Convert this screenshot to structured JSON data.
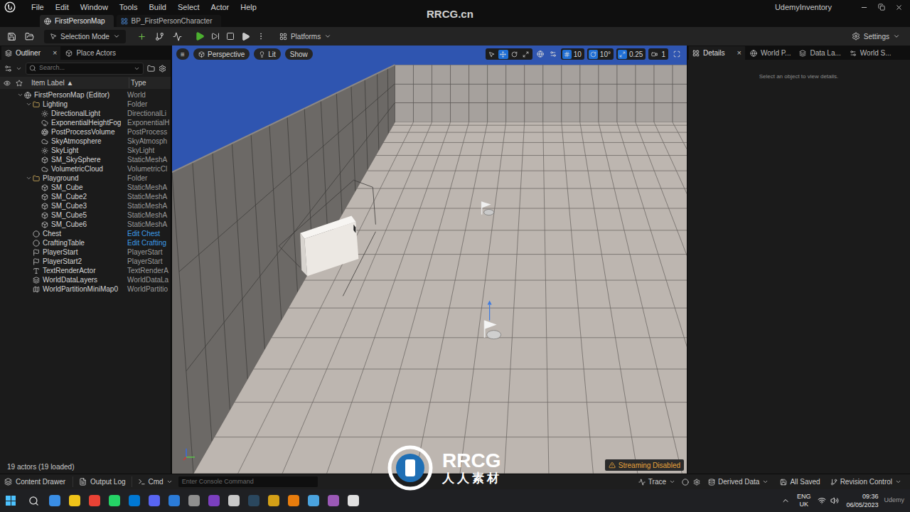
{
  "menu": [
    "File",
    "Edit",
    "Window",
    "Tools",
    "Build",
    "Select",
    "Actor",
    "Help"
  ],
  "project": "UdemyInventory",
  "document_tabs": [
    {
      "label": "FirstPersonMap",
      "selected": true
    },
    {
      "label": "BP_FirstPersonCharacter",
      "selected": false
    }
  ],
  "toolbar": {
    "mode": "Selection Mode",
    "platforms": "Platforms",
    "settings": "Settings"
  },
  "outliner": {
    "tabs": [
      {
        "label": "Outliner",
        "selected": true,
        "close": "×"
      },
      {
        "label": "Place Actors",
        "selected": false,
        "close": ""
      }
    ],
    "search": {
      "placeholder": "Search..."
    },
    "columns": [
      "Item Label ▲",
      "Type"
    ],
    "rows": [
      {
        "label": "FirstPersonMap (Editor)",
        "type": "World",
        "depth": 0,
        "kind": "world",
        "expanded": true,
        "selected": false
      },
      {
        "label": "Lighting",
        "type": "Folder",
        "depth": 1,
        "kind": "folder",
        "expanded": true,
        "selected": false
      },
      {
        "label": "DirectionalLight",
        "type": "DirectionalLi",
        "depth": 2,
        "kind": "light",
        "expanded": false,
        "selected": false
      },
      {
        "label": "ExponentialHeightFog",
        "type": "ExponentialH",
        "depth": 2,
        "kind": "fog",
        "expanded": false,
        "selected": false
      },
      {
        "label": "PostProcessVolume",
        "type": "PostProcess",
        "depth": 2,
        "kind": "volume",
        "expanded": false,
        "selected": false
      },
      {
        "label": "SkyAtmosphere",
        "type": "SkyAtmosph",
        "depth": 2,
        "kind": "sky",
        "expanded": false,
        "selected": false
      },
      {
        "label": "SkyLight",
        "type": "SkyLight",
        "depth": 2,
        "kind": "light",
        "expanded": false,
        "selected": false
      },
      {
        "label": "SM_SkySphere",
        "type": "StaticMeshA",
        "depth": 2,
        "kind": "mesh",
        "expanded": false,
        "selected": false
      },
      {
        "label": "VolumetricCloud",
        "type": "VolumetricCl",
        "depth": 2,
        "kind": "cloud",
        "expanded": false,
        "selected": false
      },
      {
        "label": "Playground",
        "type": "Folder",
        "depth": 1,
        "kind": "folder",
        "expanded": true,
        "selected": false
      },
      {
        "label": "SM_Cube",
        "type": "StaticMeshA",
        "depth": 2,
        "kind": "mesh",
        "expanded": false,
        "selected": false
      },
      {
        "label": "SM_Cube2",
        "type": "StaticMeshA",
        "depth": 2,
        "kind": "mesh",
        "expanded": false,
        "selected": false
      },
      {
        "label": "SM_Cube3",
        "type": "StaticMeshA",
        "depth": 2,
        "kind": "mesh",
        "expanded": false,
        "selected": false
      },
      {
        "label": "SM_Cube5",
        "type": "StaticMeshA",
        "depth": 2,
        "kind": "mesh",
        "expanded": false,
        "selected": false
      },
      {
        "label": "SM_Cube6",
        "type": "StaticMeshA",
        "depth": 2,
        "kind": "mesh",
        "expanded": false,
        "selected": false
      },
      {
        "label": "Chest",
        "type": "Edit Chest",
        "depth": 1,
        "kind": "blueprint",
        "expanded": false,
        "selected": false
      },
      {
        "label": "CraftingTable",
        "type": "Edit Crafting",
        "depth": 1,
        "kind": "blueprint",
        "expanded": false,
        "selected": false
      },
      {
        "label": "PlayerStart",
        "type": "PlayerStart",
        "depth": 1,
        "kind": "start",
        "expanded": false,
        "selected": false
      },
      {
        "label": "PlayerStart2",
        "type": "PlayerStart",
        "depth": 1,
        "kind": "start",
        "expanded": false,
        "selected": false
      },
      {
        "label": "TextRenderActor",
        "type": "TextRenderA",
        "depth": 1,
        "kind": "text",
        "expanded": false,
        "selected": false
      },
      {
        "label": "WorldDataLayers",
        "type": "WorldDataLa",
        "depth": 1,
        "kind": "data",
        "expanded": false,
        "selected": false
      },
      {
        "label": "WorldPartitionMiniMap0",
        "type": "WorldPartitio",
        "depth": 1,
        "kind": "map",
        "expanded": false,
        "selected": false
      }
    ],
    "footer": "19 actors (19 loaded)"
  },
  "viewport": {
    "menu": "≡",
    "view": "Perspective",
    "lighting": "Lit",
    "show": "Show",
    "transform_tools": [
      {
        "kind": "select",
        "selected": false
      },
      {
        "kind": "move",
        "selected": true
      },
      {
        "kind": "rotate",
        "selected": false
      },
      {
        "kind": "scale",
        "selected": false
      }
    ],
    "snaps": [
      {
        "kind": "grid",
        "value": "10",
        "active": true
      },
      {
        "kind": "rotation",
        "value": "10°",
        "active": true
      },
      {
        "kind": "scale",
        "value": "0.25",
        "active": true
      },
      {
        "kind": "camera",
        "value": "1",
        "active": false
      }
    ],
    "badge": "Streaming Disabled"
  },
  "details": {
    "tabs": [
      {
        "label": "Details",
        "selected": true,
        "close": "×"
      },
      {
        "label": "World P...",
        "selected": false,
        "close": ""
      },
      {
        "label": "Data La...",
        "selected": false,
        "close": ""
      },
      {
        "label": "World S...",
        "selected": false,
        "close": ""
      }
    ],
    "empty_text": "Select an object to view details."
  },
  "bottom_bar": {
    "content_drawer": "Content Drawer",
    "output_log": "Output Log",
    "cmd": "Cmd",
    "console_placeholder": "Enter Console Command",
    "trace": "Trace",
    "derived_data": "Derived Data",
    "saved": "All Saved",
    "revision_control": "Revision Control"
  },
  "taskbar": {
    "language": "ENG",
    "region": "UK",
    "time": "09:36",
    "date": "06/05/2023"
  },
  "watermark": {
    "top": "RRCG.cn",
    "logo": "RRCG",
    "logo_sub": "人人素材",
    "corner": "Udemy"
  }
}
